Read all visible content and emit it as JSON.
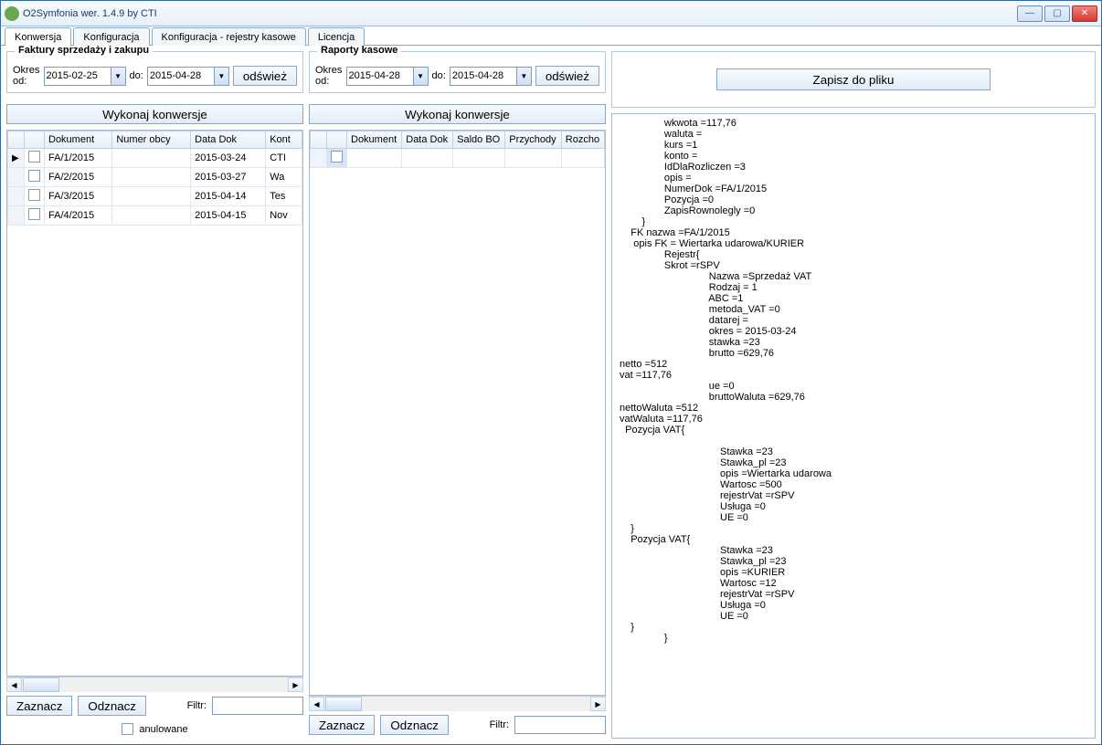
{
  "title": "O2Symfonia  wer. 1.4.9 by CTI",
  "tabs": [
    "Konwersja",
    "Konfiguracja",
    "Konfiguracja - rejestry kasowe",
    "Licencja"
  ],
  "left": {
    "legend": "Faktury sprzedaży i zakupu",
    "okres_od_label": "Okres od:",
    "date_from": "2015-02-25",
    "do_label": "do:",
    "date_to": "2015-04-28",
    "refresh": "odśwież",
    "convert": "Wykonaj konwersje",
    "cols": {
      "dokument": "Dokument",
      "numer": "Numer obcy",
      "data": "Data Dok",
      "kont": "Kont"
    },
    "rows": [
      {
        "dokument": "FA/1/2015",
        "numer": "",
        "data": "2015-03-24",
        "kont": "CTI"
      },
      {
        "dokument": "FA/2/2015",
        "numer": "",
        "data": "2015-03-27",
        "kont": "Wa"
      },
      {
        "dokument": "FA/3/2015",
        "numer": "",
        "data": "2015-04-14",
        "kont": "Tes"
      },
      {
        "dokument": "FA/4/2015",
        "numer": "",
        "data": "2015-04-15",
        "kont": "Nov"
      }
    ],
    "zaznacz": "Zaznacz",
    "odznacz": "Odznacz",
    "filtr": "Filtr:",
    "anulowane": "anulowane"
  },
  "mid": {
    "legend": "Raporty kasowe",
    "okres_od_label": "Okres od:",
    "date_from": "2015-04-28",
    "do_label": "do:",
    "date_to": "2015-04-28",
    "refresh": "odśwież",
    "convert": "Wykonaj konwersje",
    "cols": {
      "dokument": "Dokument",
      "data": "Data Dok",
      "saldo": "Saldo BO",
      "przychody": "Przychody",
      "rozcho": "Rozcho"
    },
    "zaznacz": "Zaznacz",
    "odznacz": "Odznacz",
    "filtr": "Filtr:"
  },
  "right": {
    "save": "Zapisz do pliku",
    "output": "                wkwota =117,76\n                waluta =\n                kurs =1\n                konto =\n                IdDlaRozliczen =3\n                opis =\n                NumerDok =FA/1/2015\n                Pozycja =0\n                ZapisRownolegly =0\n        }\n    FK nazwa =FA/1/2015\n     opis FK = Wiertarka udarowa/KURIER\n                Rejestr{\n                Skrot =rSPV\n                                Nazwa =Sprzedaż VAT\n                                Rodzaj = 1\n                                ABC =1\n                                metoda_VAT =0\n                                datarej =\n                                okres = 2015-03-24\n                                stawka =23\n                                brutto =629,76\nnetto =512\nvat =117,76\n                                ue =0\n                                bruttoWaluta =629,76\nnettoWaluta =512\nvatWaluta =117,76\n  Pozycja VAT{\n\n                                    Stawka =23\n                                    Stawka_pl =23\n                                    opis =Wiertarka udarowa\n                                    Wartosc =500\n                                    rejestrVat =rSPV\n                                    Usługa =0\n                                    UE =0\n    }\n    Pozycja VAT{\n                                    Stawka =23\n                                    Stawka_pl =23\n                                    opis =KURIER\n                                    Wartosc =12\n                                    rejestrVat =rSPV\n                                    Usługa =0\n                                    UE =0\n    }\n                }"
  }
}
